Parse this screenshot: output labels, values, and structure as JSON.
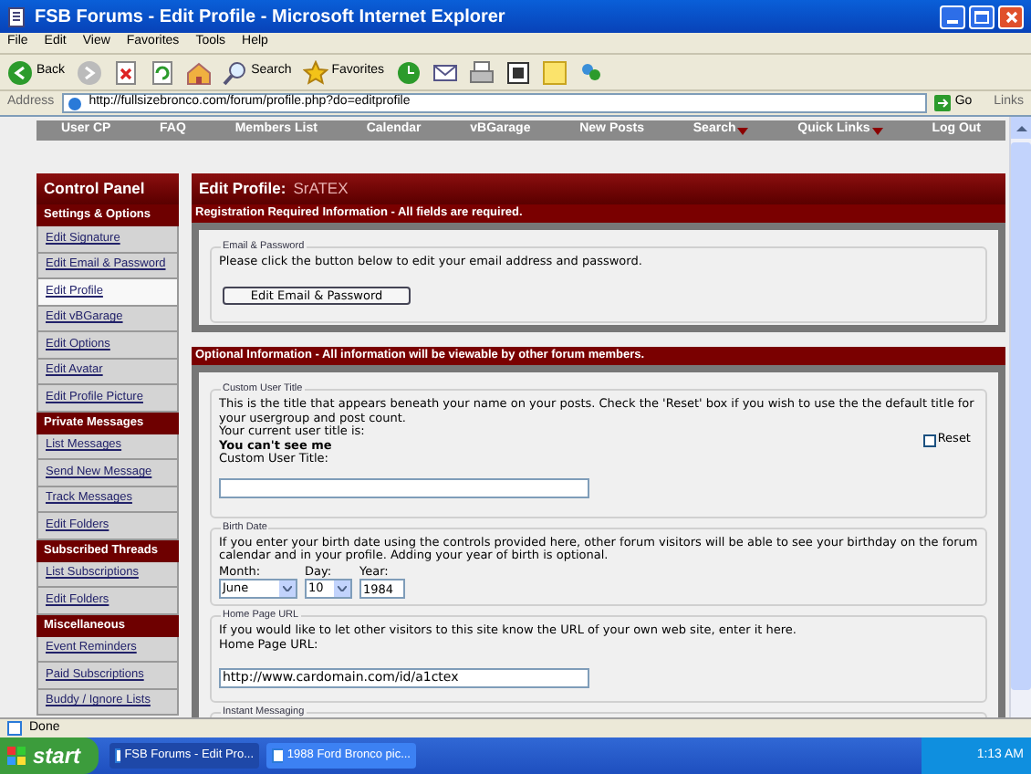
{
  "window": {
    "title": "FSB Forums - Edit Profile - Microsoft Internet Explorer"
  },
  "menu": [
    "File",
    "Edit",
    "View",
    "Favorites",
    "Tools",
    "Help"
  ],
  "toolbar": [
    {
      "kind": "back",
      "label": "Back"
    },
    {
      "kind": "forward"
    },
    {
      "kind": "stop"
    },
    {
      "kind": "refresh"
    },
    {
      "kind": "home"
    },
    {
      "kind": "search",
      "label": "Search"
    },
    {
      "kind": "favorites",
      "label": "Favorites"
    },
    {
      "kind": "history"
    },
    {
      "kind": "mail"
    },
    {
      "kind": "print"
    },
    {
      "kind": "edit"
    },
    {
      "kind": "note"
    },
    {
      "kind": "messenger"
    }
  ],
  "address_bar": {
    "label": "Address",
    "url": "http://fullsizebronco.com/forum/profile.php?do=editprofile",
    "go": "Go",
    "links": "Links"
  },
  "nav": [
    {
      "label": "User CP",
      "dropdown": false
    },
    {
      "label": "FAQ",
      "dropdown": false
    },
    {
      "label": "Members List",
      "dropdown": false
    },
    {
      "label": "Calendar",
      "dropdown": false
    },
    {
      "label": "vBGarage",
      "dropdown": false
    },
    {
      "label": "New Posts",
      "dropdown": false
    },
    {
      "label": "Search",
      "dropdown": true
    },
    {
      "label": "Quick Links",
      "dropdown": true
    },
    {
      "label": "Log Out",
      "dropdown": false
    }
  ],
  "sidebar": {
    "title": "Control Panel",
    "sections": [
      {
        "title": "Settings & Options",
        "items": [
          {
            "label": "Edit Signature",
            "selected": false
          },
          {
            "label": "Edit Email & Password",
            "selected": false
          },
          {
            "label": "Edit Profile",
            "selected": true
          },
          {
            "label": "Edit vBGarage",
            "selected": false
          },
          {
            "label": "Edit Options",
            "selected": false
          },
          {
            "label": "Edit Avatar",
            "selected": false
          },
          {
            "label": "Edit Profile Picture",
            "selected": false
          }
        ]
      },
      {
        "title": "Private Messages",
        "items": [
          {
            "label": "List Messages",
            "selected": false
          },
          {
            "label": "Send New Message",
            "selected": false
          },
          {
            "label": "Track Messages",
            "selected": false
          },
          {
            "label": "Edit Folders",
            "selected": false
          }
        ]
      },
      {
        "title": "Subscribed Threads",
        "items": [
          {
            "label": "List Subscriptions",
            "selected": false
          },
          {
            "label": "Edit Folders",
            "selected": false
          }
        ]
      },
      {
        "title": "Miscellaneous",
        "items": [
          {
            "label": "Event Reminders",
            "selected": false
          },
          {
            "label": "Paid Subscriptions",
            "selected": false
          },
          {
            "label": "Buddy / Ignore Lists",
            "selected": false
          }
        ]
      }
    ]
  },
  "main": {
    "title": "Edit Profile:",
    "username": "SrATEX",
    "required": {
      "heading": "Registration Required Information - All fields are required.",
      "legend": "Email & Password",
      "text": "Please click the button below to edit your email address and password.",
      "button": "Edit Email & Password"
    },
    "optional": {
      "heading": "Optional Information - All information will be viewable by other forum members.",
      "custom_title": {
        "legend": "Custom User Title",
        "text": "This is the title that appears beneath your name on your posts. Check the 'Reset' box if you wish to use the the default title for your usergroup and post count.",
        "current_label": "Your current user title is:",
        "current": "You can't see me",
        "reset": {
          "label": "Reset",
          "checked": false
        },
        "field_label": "Custom User Title:"
      },
      "birth_date": {
        "legend": "Birth Date",
        "text": "If you enter your birth date using the controls provided here, other forum visitors will be able to see your birthday on the forum calendar and in your profile. Adding your year of birth is optional.",
        "month_label": "Month:",
        "month": "June",
        "day_label": "Day:",
        "day": "10",
        "year_label": "Year:",
        "year": "1984"
      },
      "home_page": {
        "legend": "Home Page URL",
        "text": "If you would like to let other visitors to this site know the URL of your own web site, enter it here.",
        "field_label": "Home Page URL:",
        "value": "http://www.cardomain.com/id/a1ctex"
      },
      "instant_messaging": {
        "legend": "Instant Messaging"
      }
    }
  },
  "status_bar": {
    "text": "Done"
  },
  "taskbar": {
    "start": "start",
    "tasks": [
      {
        "label": "FSB Forums - Edit Pro...",
        "selected": true
      },
      {
        "label": "1988 Ford Bronco pic...",
        "selected": false
      }
    ],
    "clock": "1:13 AM"
  }
}
